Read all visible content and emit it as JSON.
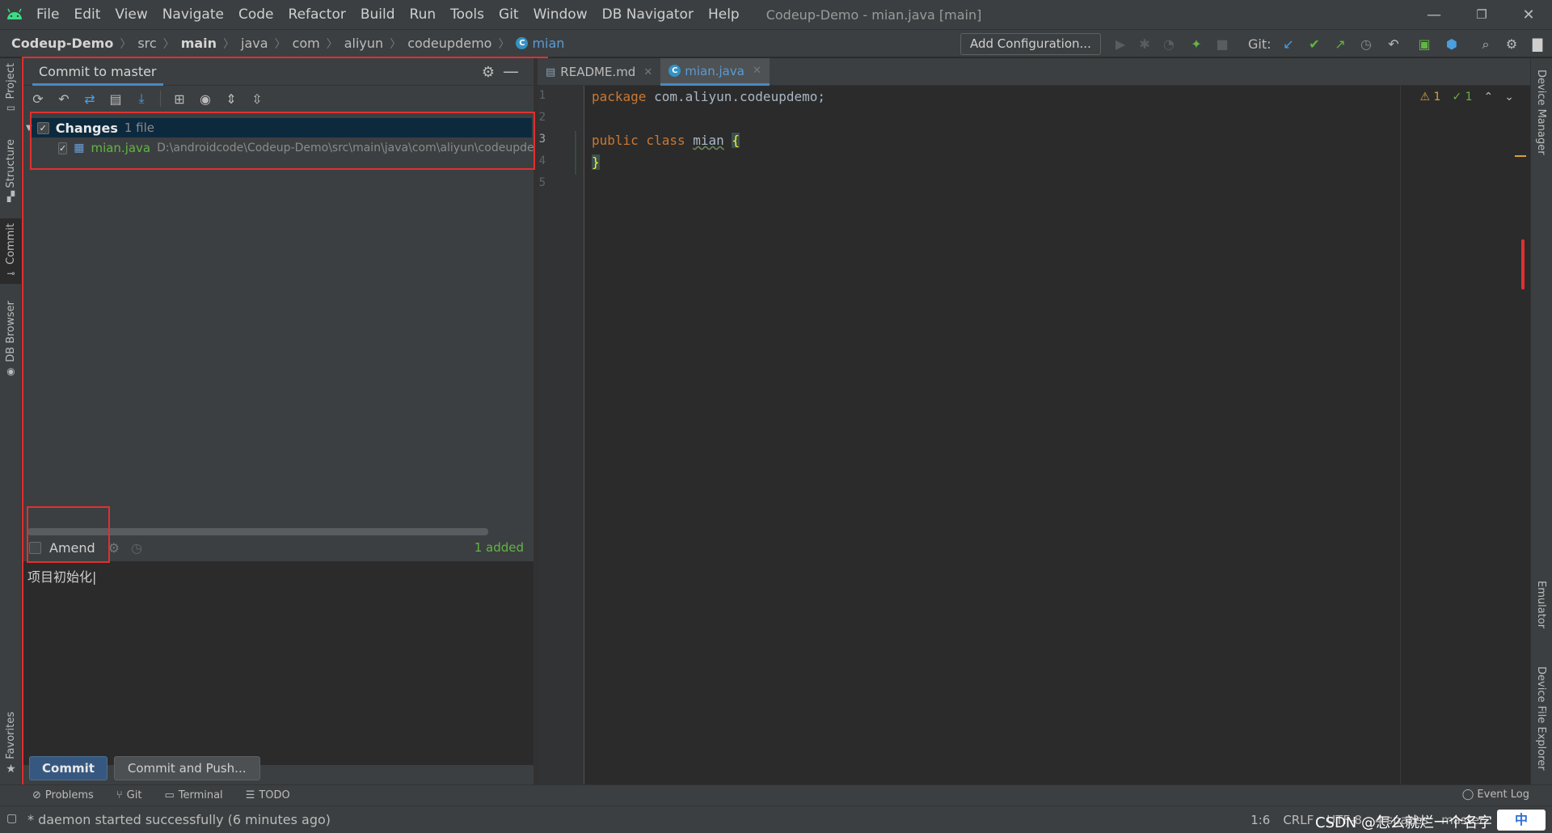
{
  "window": {
    "title": "Codeup-Demo - mian.java [main]",
    "controls": {
      "minimize": "—",
      "restore": "❐",
      "close": "✕"
    }
  },
  "menu": [
    "File",
    "Edit",
    "View",
    "Navigate",
    "Code",
    "Refactor",
    "Build",
    "Run",
    "Tools",
    "Git",
    "Window",
    "DB Navigator",
    "Help"
  ],
  "breadcrumb": {
    "project": "Codeup-Demo",
    "parts": [
      "src",
      "main",
      "java",
      "com",
      "aliyun",
      "codeupdemo"
    ],
    "current": "mian",
    "class_icon_letter": "C"
  },
  "navbar": {
    "add_configuration": "Add Configuration...",
    "git_label": "Git:"
  },
  "left_tabs": {
    "project": "Project",
    "structure": "Structure",
    "commit": "Commit",
    "db_browser": "DB Browser",
    "favorites": "Favorites"
  },
  "right_tabs": {
    "device_manager": "Device Manager",
    "emulator": "Emulator",
    "device_file_explorer": "Device File Explorer"
  },
  "commit_panel": {
    "tab_title": "Commit to master",
    "changes_label": "Changes",
    "changes_count": "1 file",
    "file_name": "mian.java",
    "file_path": "D:\\androidcode\\Codeup-Demo\\src\\main\\java\\com\\aliyun\\codeupdemo",
    "amend_label": "Amend",
    "added_count": "1 added",
    "message": "项目初始化",
    "commit_button": "Commit",
    "commit_push_button": "Commit and Push..."
  },
  "editor": {
    "tabs": [
      {
        "label": "README.md",
        "active": false
      },
      {
        "label": "mian.java",
        "active": true
      }
    ],
    "line_numbers": [
      "1",
      "2",
      "3",
      "4",
      "5"
    ],
    "code": {
      "line1_kw": "package",
      "line1_rest": " com.aliyun.codeupdemo;",
      "line3_kw": "public class",
      "line3_name": "mian",
      "line3_brace": "{",
      "line4_brace": "}"
    },
    "warnings": "⚠ 1",
    "ok_count": "✓ 1"
  },
  "bottom_tools": [
    "Problems",
    "Git",
    "Terminal",
    "TODO"
  ],
  "event_log": "Event Log",
  "status": {
    "message": "* daemon started successfully (6 minutes ago)",
    "position": "1:6",
    "line_separator": "CRLF",
    "encoding": "UTF-8",
    "indent": "4 spaces",
    "branch": "master"
  },
  "watermark": "CSDN @怎么就烂一个名字",
  "ime_badge": "中",
  "colors": {
    "highlight_box": "#e03030",
    "accent_blue": "#4a88c7",
    "added_green": "#62b543",
    "keyword_orange": "#cc7832"
  }
}
